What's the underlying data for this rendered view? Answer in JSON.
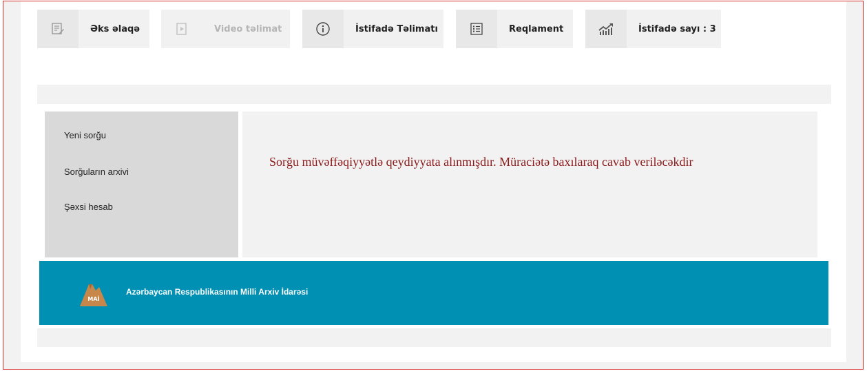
{
  "toolbar": {
    "feedback_label": "Əks əlaqə",
    "video_label": "Video təlimat",
    "instructions_label": "İstifadə Təlimatı",
    "regulation_label": "Reqlament",
    "usage_label": "İstifadə sayı : 3"
  },
  "sidebar": {
    "items": [
      {
        "label": "Yeni sorğu"
      },
      {
        "label": "Sorğuların arxivi"
      },
      {
        "label": "Şəxsi hesab"
      }
    ]
  },
  "main": {
    "message": "Sorğu müvəffəqiyyətlə qeydiyyata alınmışdır. Müraciətə baxılaraq cavab veriləcəkdir"
  },
  "footer": {
    "org_name": "Azərbaycan Respublikasının Milli Arxiv İdarəsi",
    "logo_text": "MAİ"
  },
  "colors": {
    "frame_border": "#d42a2a",
    "footer_bg": "#0090b4",
    "message_text": "#8b1a1a",
    "sidebar_bg": "#d9d9d9",
    "logo_fill": "#c8874a"
  },
  "icons": [
    "edit-icon",
    "video-icon",
    "info-icon",
    "list-icon",
    "chart-up-icon",
    "archive-logo"
  ]
}
